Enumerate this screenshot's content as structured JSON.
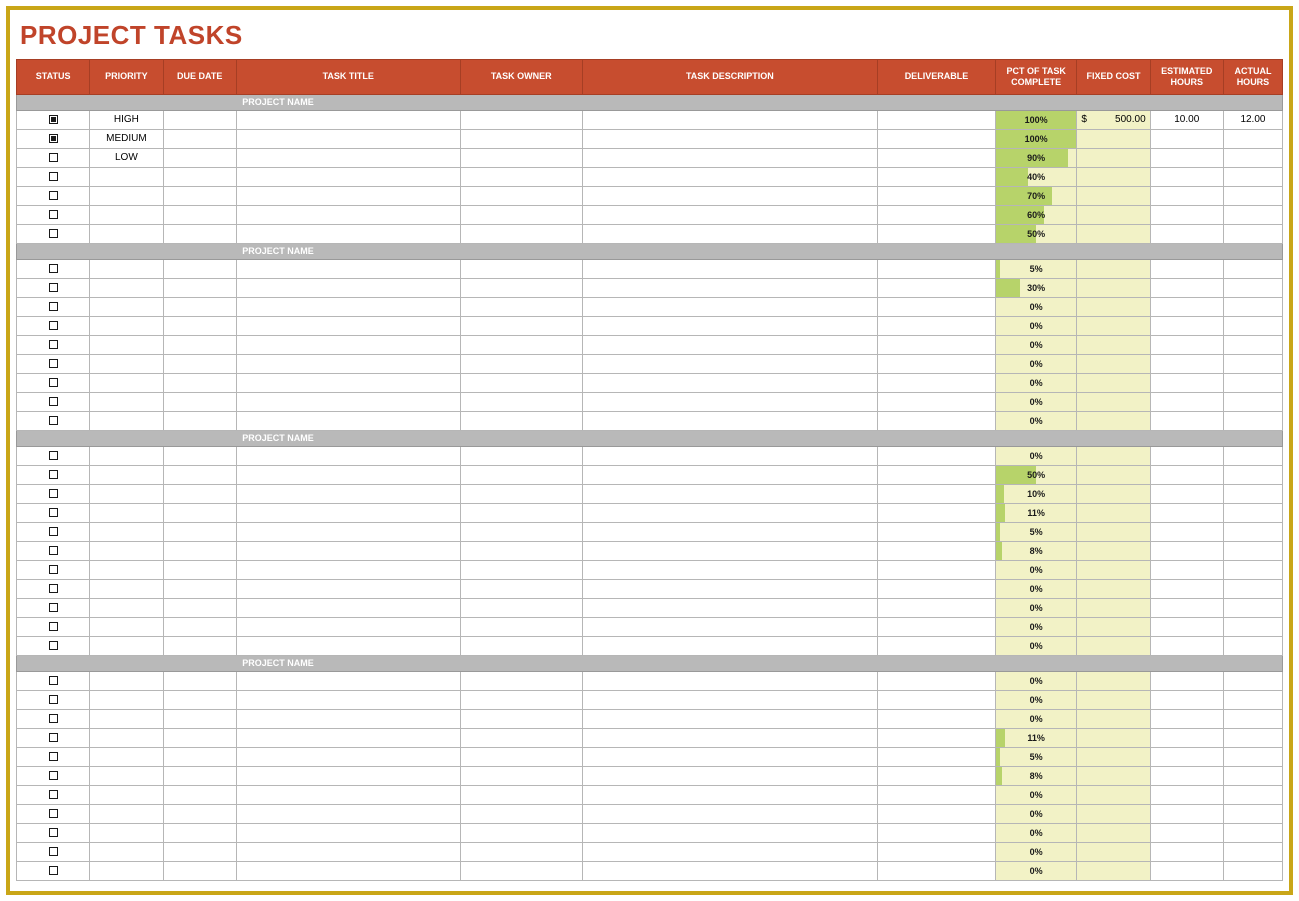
{
  "title": "PROJECT TASKS",
  "columns": {
    "status": "STATUS",
    "priority": "PRIORITY",
    "due_date": "DUE DATE",
    "task_title": "TASK TITLE",
    "task_owner": "TASK OWNER",
    "task_description": "TASK DESCRIPTION",
    "deliverable": "DELIVERABLE",
    "pct_complete": "PCT OF TASK COMPLETE",
    "fixed_cost": "FIXED COST",
    "est_hours": "ESTIMATED HOURS",
    "act_hours": "ACTUAL HOURS"
  },
  "section_label": "PROJECT NAME",
  "sections": [
    {
      "rows": [
        {
          "checked": true,
          "priority": "HIGH",
          "pct": 100,
          "fixed_cost_currency": "$",
          "fixed_cost": "500.00",
          "est": "10.00",
          "act": "12.00"
        },
        {
          "checked": true,
          "priority": "MEDIUM",
          "pct": 100
        },
        {
          "checked": false,
          "priority": "LOW",
          "pct": 90
        },
        {
          "checked": false,
          "pct": 40
        },
        {
          "checked": false,
          "pct": 70
        },
        {
          "checked": false,
          "pct": 60
        },
        {
          "checked": false,
          "pct": 50
        }
      ]
    },
    {
      "rows": [
        {
          "checked": false,
          "pct": 5
        },
        {
          "checked": false,
          "pct": 30
        },
        {
          "checked": false,
          "pct": 0
        },
        {
          "checked": false,
          "pct": 0
        },
        {
          "checked": false,
          "pct": 0
        },
        {
          "checked": false,
          "pct": 0
        },
        {
          "checked": false,
          "pct": 0
        },
        {
          "checked": false,
          "pct": 0
        },
        {
          "checked": false,
          "pct": 0
        }
      ]
    },
    {
      "rows": [
        {
          "checked": false,
          "pct": 0
        },
        {
          "checked": false,
          "pct": 50
        },
        {
          "checked": false,
          "pct": 10
        },
        {
          "checked": false,
          "pct": 11
        },
        {
          "checked": false,
          "pct": 5
        },
        {
          "checked": false,
          "pct": 8
        },
        {
          "checked": false,
          "pct": 0
        },
        {
          "checked": false,
          "pct": 0
        },
        {
          "checked": false,
          "pct": 0
        },
        {
          "checked": false,
          "pct": 0
        },
        {
          "checked": false,
          "pct": 0
        }
      ]
    },
    {
      "rows": [
        {
          "checked": false,
          "pct": 0
        },
        {
          "checked": false,
          "pct": 0
        },
        {
          "checked": false,
          "pct": 0
        },
        {
          "checked": false,
          "pct": 11
        },
        {
          "checked": false,
          "pct": 5
        },
        {
          "checked": false,
          "pct": 8
        },
        {
          "checked": false,
          "pct": 0
        },
        {
          "checked": false,
          "pct": 0
        },
        {
          "checked": false,
          "pct": 0
        },
        {
          "checked": false,
          "pct": 0
        },
        {
          "checked": false,
          "pct": 0
        }
      ]
    }
  ]
}
